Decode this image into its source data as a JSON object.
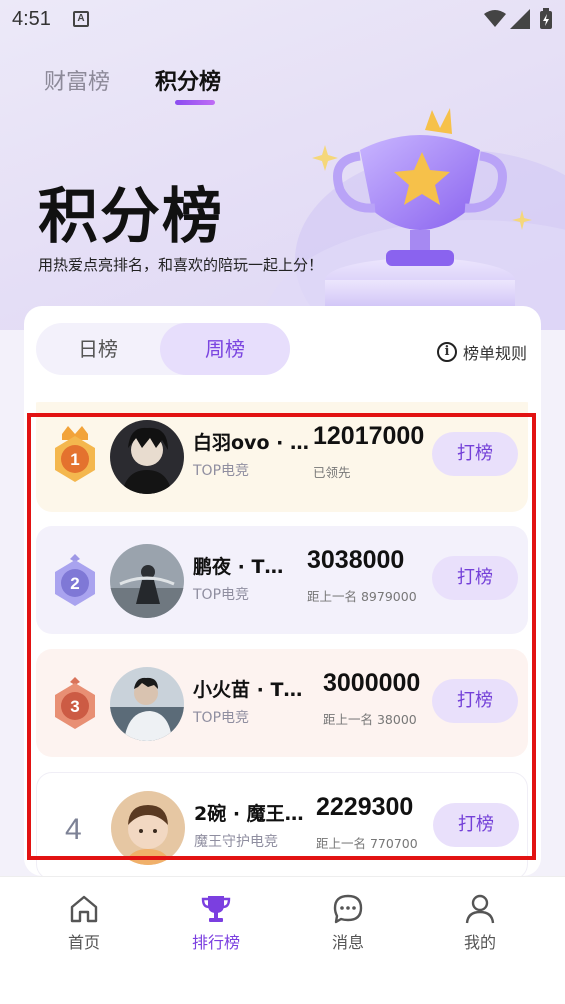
{
  "status_bar": {
    "time": "4:51",
    "notification_icon": "A"
  },
  "top_tabs": [
    {
      "label": "财富榜",
      "active": false
    },
    {
      "label": "积分榜",
      "active": true
    }
  ],
  "hero": {
    "title": "积分榜",
    "subtitle": "用热爱点亮排名，和喜欢的陪玩一起上分！"
  },
  "period_tabs": [
    {
      "label": "日榜",
      "active": false
    },
    {
      "label": "周榜",
      "active": true
    }
  ],
  "rules_label": "榜单规则",
  "ranking": [
    {
      "rank": "1",
      "name": "白羽ovo · …",
      "tag": "TOP电竞",
      "score": "12017000",
      "gap": "已领先",
      "button": "打榜",
      "medal": "gold-medal-icon"
    },
    {
      "rank": "2",
      "name": "鹏夜 · T…",
      "tag": "TOP电竞",
      "score": "3038000",
      "gap": "距上一名 8979000",
      "button": "打榜",
      "medal": "silver-medal-icon"
    },
    {
      "rank": "3",
      "name": "小火苗 · T…",
      "tag": "TOP电竞",
      "score": "3000000",
      "gap": "距上一名 38000",
      "button": "打榜",
      "medal": "bronze-medal-icon"
    },
    {
      "rank": "4",
      "name": "2碗 · 魔王…",
      "tag": "魔王守护电竞",
      "score": "2229300",
      "gap": "距上一名 770700",
      "button": "打榜",
      "medal": ""
    }
  ],
  "bottom_nav": [
    {
      "label": "首页",
      "icon": "home-icon",
      "active": false
    },
    {
      "label": "排行榜",
      "icon": "trophy-icon",
      "active": true
    },
    {
      "label": "消息",
      "icon": "message-icon",
      "active": false
    },
    {
      "label": "我的",
      "icon": "profile-icon",
      "active": false
    }
  ],
  "colors": {
    "accent": "#7b3fe0",
    "highlight_box": "#e21212",
    "gold": "#f2a33a",
    "silver": "#8b86d8",
    "bronze": "#de7a5e"
  }
}
